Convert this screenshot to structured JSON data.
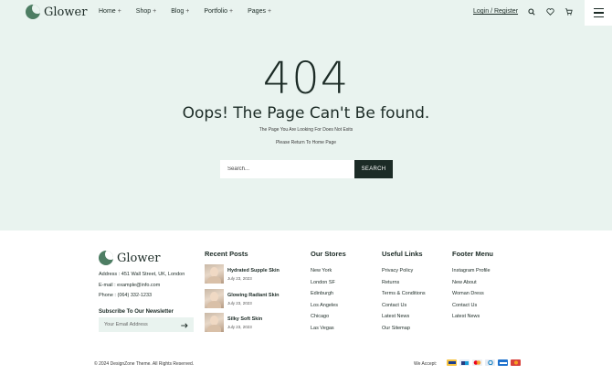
{
  "brand": {
    "name": "Glower",
    "accent": "#4d7d63",
    "dark": "#1c2b26",
    "hero_bg": "#e9f3ef"
  },
  "nav": {
    "items": [
      {
        "label": "Home",
        "marker": "+"
      },
      {
        "label": "Shop",
        "marker": "+"
      },
      {
        "label": "Blog",
        "marker": "+"
      },
      {
        "label": "Portfolio",
        "marker": "+"
      },
      {
        "label": "Pages",
        "marker": "+"
      }
    ],
    "login": "Login / Register",
    "icons": [
      "search-icon",
      "heart-icon",
      "cart-icon",
      "hamburger-icon"
    ]
  },
  "error": {
    "code": "404",
    "heading": "Oops! The Page Can't Be found.",
    "subtitle": "The Page You Are Looking For Does Not Exits",
    "return_text": "Please Return To Home Page",
    "search_placeholder": "Search...",
    "search_button": "SEARCH"
  },
  "footer": {
    "logo": "Glower",
    "address": "Address : 451 Wall Street, UK, London",
    "email": "E-mail : example@info.com",
    "phone": "Phone : (064) 332-1233",
    "newsletter_title": "Subscribe To Our Newsletter",
    "newsletter_placeholder": "Your Email Address",
    "recent_posts": {
      "title": "Recent Posts",
      "items": [
        {
          "title": "Hydrated Supple Skin",
          "date": "July 23, 2023"
        },
        {
          "title": "Glowing Radiant Skin",
          "date": "July 23, 2023"
        },
        {
          "title": "Silky Soft Skin",
          "date": "July 23, 2023"
        }
      ]
    },
    "stores": {
      "title": "Our Stores",
      "items": [
        "New York",
        "London SF",
        "Edinburgh",
        "Los Angeles",
        "Chicago",
        "Las Vegas"
      ]
    },
    "useful": {
      "title": "Useful Links",
      "items": [
        "Privacy Policy",
        "Returns",
        "Terms & Conditions",
        "Contact Us",
        "Latest News",
        "Our Sitemap"
      ]
    },
    "menu": {
      "title": "Footer Menu",
      "items": [
        "Instagram Profile",
        "New About",
        "Woman Dress",
        "Contact Us",
        "Latest News"
      ]
    },
    "copyright": "© 2024 DesignZone Theme. All Rights Reserved.",
    "we_accept": "We Accept:",
    "payment_icons": [
      "visa-icon",
      "paypal-icon",
      "mastercard-icon",
      "diners-icon",
      "amex-icon",
      "discover-icon"
    ]
  }
}
